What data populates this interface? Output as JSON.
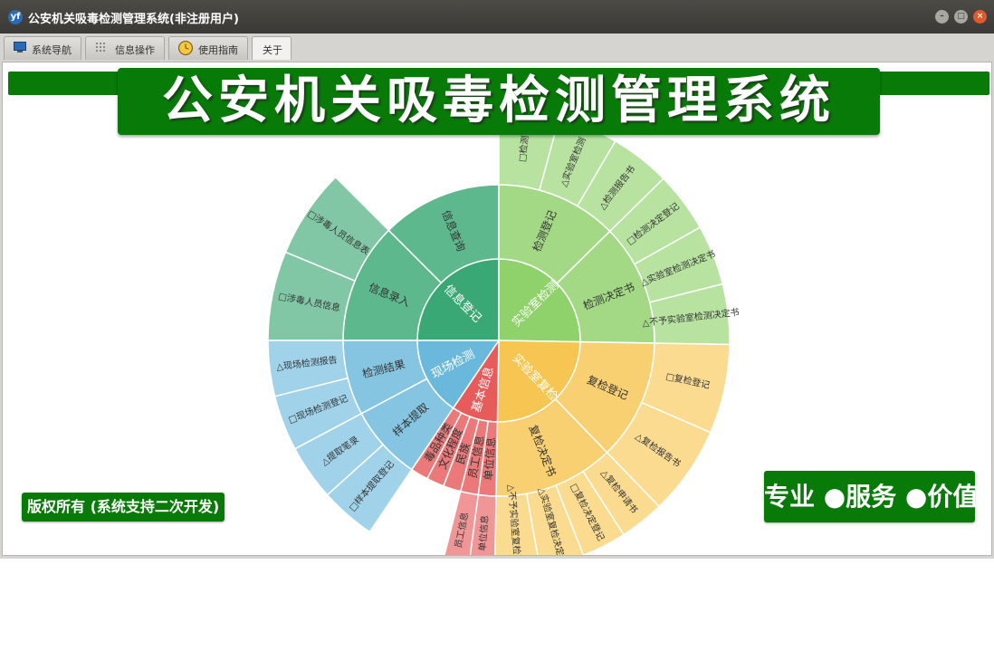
{
  "window": {
    "title": "公安机关吸毒检测管理系统(非注册用户)",
    "app_icon": "yf",
    "controls": [
      "minimize-icon",
      "maximize-icon",
      "close-icon"
    ]
  },
  "tabs": [
    {
      "label": "系统导航",
      "icon": "monitor-icon"
    },
    {
      "label": "信息操作",
      "icon": "grid-icon"
    },
    {
      "label": "使用指南",
      "icon": "clock-icon"
    },
    {
      "label": "关于",
      "icon": ""
    }
  ],
  "active_tab": 3,
  "banner": {
    "title": "公安机关吸毒检测管理系统"
  },
  "copyright": "版权所有 (系统支持二次开发)",
  "slogan": "专业 ●服务 ●价值",
  "colors": {
    "brand_green": "#087a08"
  },
  "sunburst": [
    {
      "label": "信息登记",
      "color": "#3aa874",
      "children": [
        {
          "label": "信息录入",
          "children": [
            {
              "label": "□涉毒人员信息"
            },
            {
              "label": "□涉毒人员信息表"
            }
          ]
        },
        {
          "label": "信息查询",
          "children": []
        }
      ]
    },
    {
      "label": "实验室检测",
      "color": "#8fd16a",
      "children": [
        {
          "label": "检测登记",
          "children": [
            {
              "label": "□检测"
            },
            {
              "label": "△实验室检测"
            },
            {
              "label": "△检测报告书"
            }
          ]
        },
        {
          "label": "检测决定书",
          "children": [
            {
              "label": "□检测决定登记"
            },
            {
              "label": "△实验室检测决定书"
            },
            {
              "label": "△不予实验室检测决定书"
            }
          ]
        }
      ]
    },
    {
      "label": "实验室复检",
      "color": "#f7c652",
      "children": [
        {
          "label": "复检登记",
          "children": [
            {
              "label": "□复检登记"
            },
            {
              "label": "△复检报告书"
            }
          ]
        },
        {
          "label": "复检决定书",
          "children": [
            {
              "label": "△复检申请书"
            },
            {
              "label": "□复检决定登记"
            },
            {
              "label": "△实验室复检决定书"
            },
            {
              "label": "△不予实验室复检决定书"
            }
          ]
        }
      ]
    },
    {
      "label": "基本信息",
      "color": "#e85b5b",
      "children": [
        {
          "label": "单位信息",
          "children": [
            {
              "label": "单位信息"
            }
          ]
        },
        {
          "label": "员工信息",
          "children": [
            {
              "label": "员工信息"
            }
          ]
        },
        {
          "label": "民族",
          "children": []
        },
        {
          "label": "文化程度",
          "children": []
        },
        {
          "label": "毒品种类",
          "children": []
        }
      ]
    },
    {
      "label": "现场检测",
      "color": "#6ab8dc",
      "children": [
        {
          "label": "样本提取",
          "children": [
            {
              "label": "□样本提取登记"
            },
            {
              "label": "△提取笔录"
            }
          ]
        },
        {
          "label": "检测结果",
          "children": [
            {
              "label": "□现场检测登记"
            },
            {
              "label": "△现场检测报告"
            }
          ]
        }
      ]
    }
  ]
}
